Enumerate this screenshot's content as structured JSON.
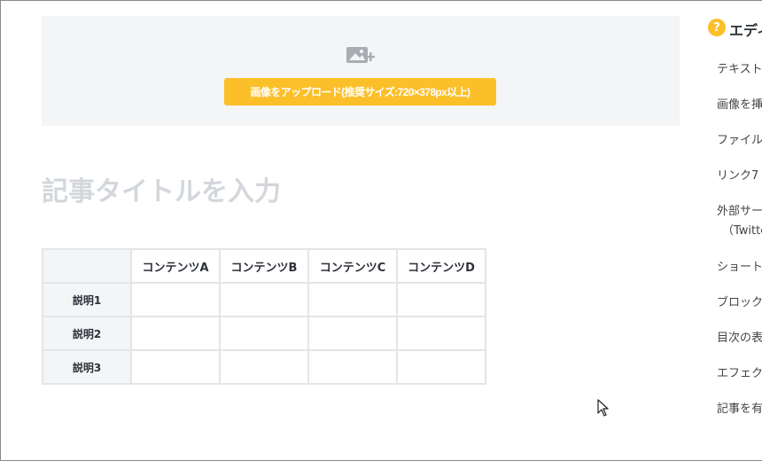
{
  "upload": {
    "icon": "add-image-icon",
    "button_label": "画像をアップロード(推奨サイズ:720×378px以上)"
  },
  "title": {
    "placeholder": "記事タイトルを入力"
  },
  "table": {
    "columns": [
      "",
      "コンテンツA",
      "コンテンツB",
      "コンテンツC",
      "コンテンツD"
    ],
    "rows": [
      {
        "label": "説明1",
        "cells": [
          "",
          "",
          "",
          ""
        ]
      },
      {
        "label": "説明2",
        "cells": [
          "",
          "",
          "",
          ""
        ]
      },
      {
        "label": "説明3",
        "cells": [
          "",
          "",
          "",
          ""
        ]
      }
    ]
  },
  "help": {
    "icon": "question-icon",
    "icon_glyph": "?",
    "title": "エディ",
    "items": [
      "テキスト",
      "画像を挿",
      "ファイル",
      "リンク7",
      "外部サー",
      "（Twitte",
      "ショート",
      "ブロック",
      "目次の表",
      "エフェク",
      "記事を有"
    ]
  },
  "colors": {
    "accent": "#fbbf2a",
    "panel_bg": "#f4f5f7",
    "border": "#e3e5e8",
    "placeholder_text": "#d3d7dc"
  }
}
